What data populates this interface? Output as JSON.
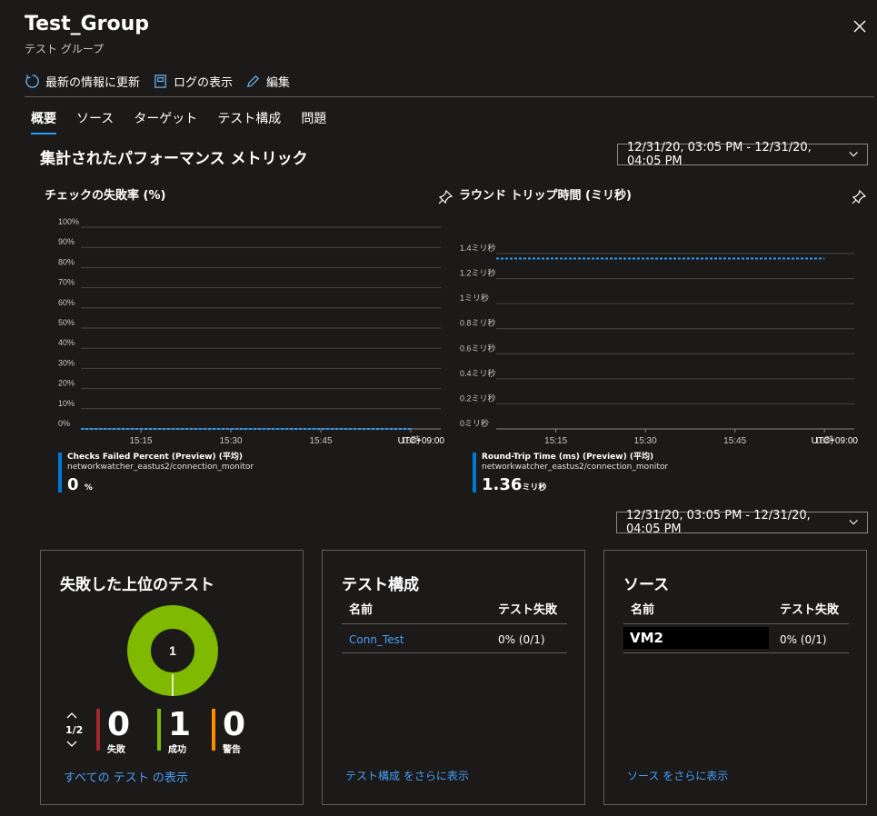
{
  "header": {
    "title": "Test_Group",
    "subtitle": "テスト グループ"
  },
  "toolbar": {
    "refresh": "最新の情報に更新",
    "logs": "ログの表示",
    "edit": "編集"
  },
  "tabs": [
    "概要",
    "ソース",
    "ターゲット",
    "テスト構成",
    "問題"
  ],
  "metrics": {
    "title": "集計されたパフォーマンス メトリック",
    "time_range": "12/31/20, 03:05 PM - 12/31/20, 04:05 PM",
    "failed_chart": {
      "title": "チェックの失敗率 (%)",
      "legend_name": "Checks Failed Percent (Preview) (平均)",
      "legend_resource": "networkwatcher_eastus2/connection_monitor",
      "legend_value": "0",
      "legend_unit": "%"
    },
    "rtt_chart": {
      "title": "ラウンド トリップ時間 (ミリ秒)",
      "legend_name": "Round-Trip Time (ms) (Preview) (平均)",
      "legend_resource": "networkwatcher_eastus2/connection_monitor",
      "legend_value": "1.36",
      "legend_unit": "ミリ秒"
    }
  },
  "chart_data": [
    {
      "type": "line",
      "title": "チェックの失敗率 (%)",
      "y_ticks": [
        "100%",
        "90%",
        "80%",
        "70%",
        "60%",
        "50%",
        "40%",
        "30%",
        "20%",
        "10%",
        "0%"
      ],
      "x_ticks": [
        "15:15",
        "15:30",
        "15:45",
        "16時"
      ],
      "x_tz": "UTC+09:00",
      "ylim": [
        0,
        100
      ],
      "x_domain": [
        "15:05",
        "16:05"
      ],
      "series": [
        {
          "name": "Checks Failed Percent (Preview) (平均)",
          "x": [
            "15:05",
            "16:00"
          ],
          "y": [
            0,
            0
          ],
          "color": "#2899f5",
          "dashed": true
        }
      ]
    },
    {
      "type": "line",
      "title": "ラウンド トリップ時間 (ミリ秒)",
      "y_ticks": [
        "1.4ミリ秒",
        "1.2ミリ秒",
        "1ミリ秒",
        "0.8ミリ秒",
        "0.6ミリ秒",
        "0.4ミリ秒",
        "0.2ミリ秒",
        "0ミリ秒"
      ],
      "x_ticks": [
        "15:15",
        "15:30",
        "15:45",
        "16時"
      ],
      "x_tz": "UTC+09:00",
      "ylim": [
        0,
        1.4
      ],
      "x_domain": [
        "15:05",
        "16:05"
      ],
      "series": [
        {
          "name": "Round-Trip Time (ms) (Preview) (平均)",
          "x": [
            "15:05",
            "16:00"
          ],
          "y": [
            1.36,
            1.36
          ],
          "color": "#2899f5",
          "dashed": true
        }
      ]
    }
  ],
  "summary": {
    "time_range": "12/31/20, 03:05 PM - 12/31/20, 04:05 PM",
    "top_failing": {
      "title": "失敗した上位のテスト",
      "donut_center": "1",
      "pager": "1/2",
      "donut_color": "#7fba00",
      "stats": [
        {
          "value": "0",
          "label": "失敗",
          "color": "#a4262c"
        },
        {
          "value": "1",
          "label": "成功",
          "color": "#7fba00"
        },
        {
          "value": "0",
          "label": "警告",
          "color": "#ff8c00"
        }
      ],
      "link": "すべての テスト の表示"
    },
    "test_config": {
      "title": "テスト構成",
      "col_name": "名前",
      "col_fail": "テスト失敗",
      "rows": [
        {
          "name": "Conn_Test",
          "fail": "0% (0/1)"
        }
      ],
      "link": "テスト構成 をさらに表示"
    },
    "sources": {
      "title": "ソース",
      "col_name": "名前",
      "col_fail": "テスト失敗",
      "rows": [
        {
          "name": "VM2",
          "fail": "0% (0/1)"
        }
      ],
      "link": "ソース をさらに表示"
    }
  }
}
